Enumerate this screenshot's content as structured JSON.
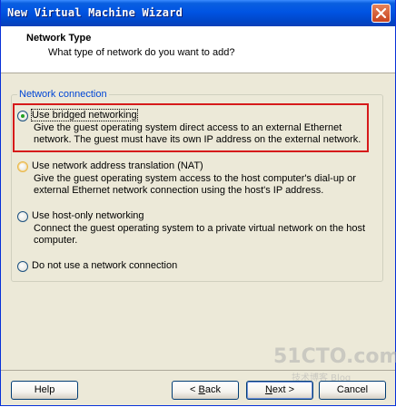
{
  "window": {
    "title": "New Virtual Machine Wizard"
  },
  "header": {
    "title": "Network Type",
    "subtitle": "What type of network do you want to add?"
  },
  "group": {
    "label": "Network connection"
  },
  "options": [
    {
      "label": "Use bridged networking",
      "selected": true,
      "description": "Give the guest operating system direct access to an external Ethernet network. The guest must have its own IP address on the external network."
    },
    {
      "label": "Use network address translation (NAT)",
      "selected": false,
      "description": "Give the guest operating system access to the host computer's dial-up or external Ethernet network connection using the host's IP address."
    },
    {
      "label": "Use host-only networking",
      "selected": false,
      "description": "Connect the guest operating system to a private virtual network on the host computer."
    },
    {
      "label": "Do not use a network connection",
      "selected": false,
      "description": ""
    }
  ],
  "buttons": {
    "help": "Help",
    "back": {
      "prefix": "< ",
      "mnemonic": "B",
      "rest": "ack"
    },
    "next": {
      "prefix": "",
      "mnemonic": "N",
      "rest": "ext >"
    },
    "cancel": "Cancel"
  },
  "watermark": {
    "main": "51CTO.com",
    "sub": "技术博客 Blog"
  },
  "colors": {
    "titlebar": "#0054e3",
    "group_label": "#0046d5",
    "highlight": "#d61a1a",
    "dialog_bg": "#ece9d8"
  },
  "icons": {
    "close": "close-icon"
  }
}
